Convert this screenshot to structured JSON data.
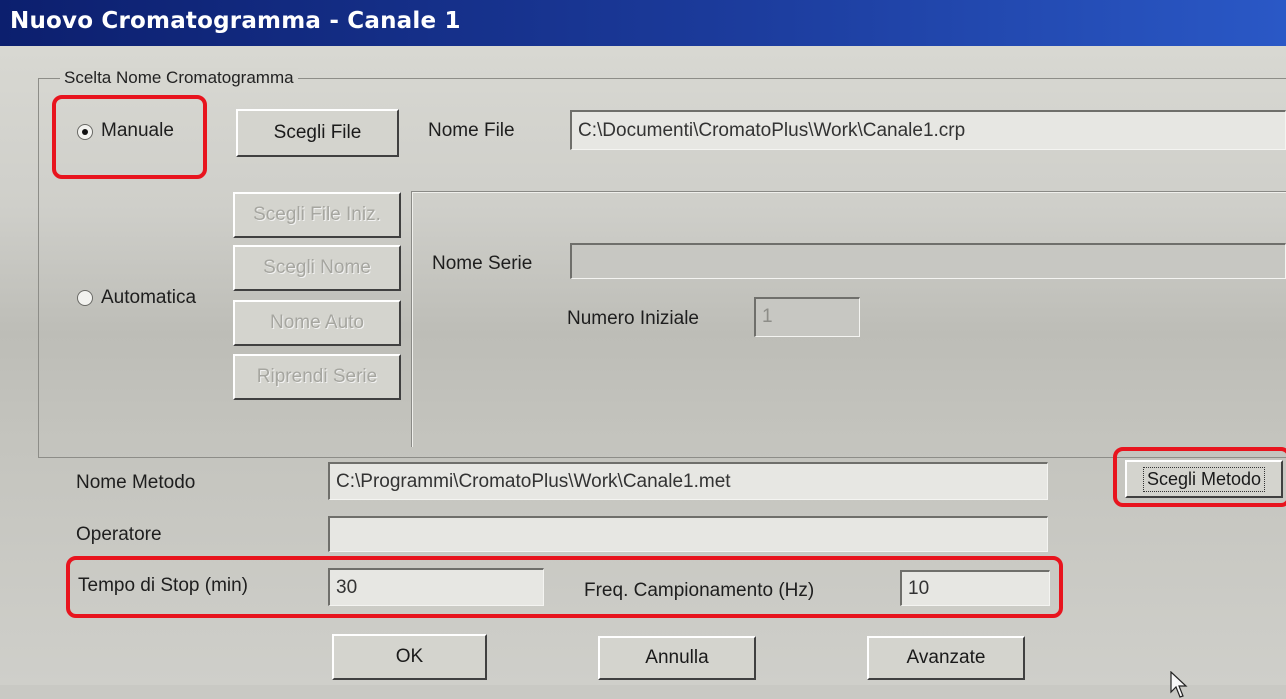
{
  "window": {
    "title": "Nuovo Cromatogramma - Canale 1"
  },
  "name_group": {
    "label": "Scelta Nome Cromatogramma",
    "manual": {
      "radio_label": "Manuale",
      "selected": true,
      "choose_file_button": "Scegli File",
      "file_name_label": "Nome File",
      "file_name_value": "C:\\Documenti\\CromatoPlus\\Work\\Canale1.crp"
    },
    "automatic": {
      "radio_label": "Automatica",
      "selected": false,
      "buttons": {
        "choose_initial_file": "Scegli File Iniz.",
        "choose_name": "Scegli Nome",
        "auto_name": "Nome Auto",
        "resume_series": "Riprendi Serie"
      },
      "series_name_label": "Nome Serie",
      "series_name_value": "",
      "initial_number_label": "Numero Iniziale",
      "initial_number_value": "1"
    }
  },
  "method": {
    "label": "Nome Metodo",
    "value": "C:\\Programmi\\CromatoPlus\\Work\\Canale1.met",
    "choose_button": "Scegli Metodo"
  },
  "operator": {
    "label": "Operatore",
    "value": ""
  },
  "stop_time": {
    "label": "Tempo di Stop (min)",
    "value": "30"
  },
  "sampling_freq": {
    "label": "Freq. Campionamento (Hz)",
    "value": "10"
  },
  "footer": {
    "ok": "OK",
    "cancel": "Annulla",
    "advanced": "Avanzate"
  },
  "colors": {
    "highlight": "#e8141e",
    "title_bar": "#1b3a9a"
  },
  "icons": {
    "cursor": "arrow-cursor-icon"
  }
}
